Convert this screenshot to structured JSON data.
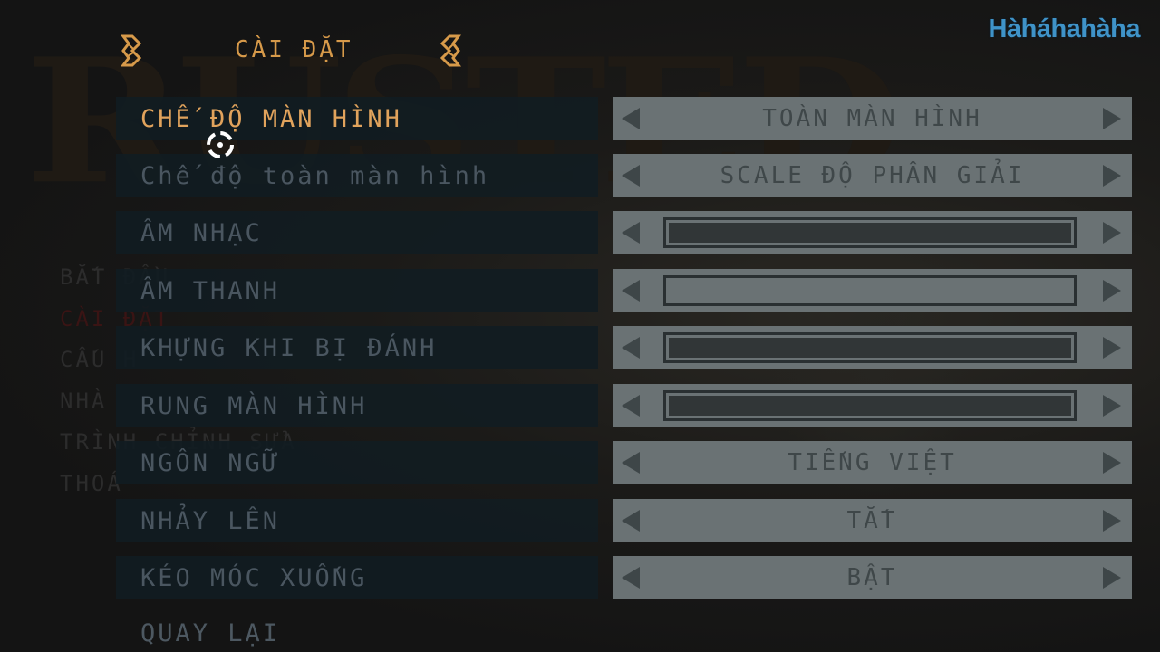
{
  "watermark": "Hàháhahàha",
  "title": "CÀI ĐẶT",
  "background_menu": [
    "BẮT ĐẦU",
    "CÀI ĐẶT",
    "CẤU H",
    "NHÀ",
    "TRÌNH CHỈNH SỬA",
    "THOÁ"
  ],
  "settings": [
    {
      "label": "CHẾ ĐỘ MÀN HÌNH",
      "value": "TOÀN MÀN HÌNH",
      "active": true
    },
    {
      "label": "Chế độ toàn màn hình",
      "value": "SCALE ĐỘ PHÂN GIẢI"
    },
    {
      "label": "ÂM NHẠC",
      "level": 1.0
    },
    {
      "label": "ÂM THANH",
      "level": 0.0
    },
    {
      "label": "KHỰNG KHI BỊ ĐÁNH",
      "level": 1.0
    },
    {
      "label": "RUNG MÀN HÌNH",
      "level": 1.0
    },
    {
      "label": "NGÔN NGỮ",
      "value": "TIẾNG VIỆT"
    },
    {
      "label": "NHẢY LÊN",
      "value": "TẮT"
    },
    {
      "label": "KÉO MÓC XUỐNG",
      "value": "BẬT"
    }
  ],
  "back_label": "QUAY LẠI",
  "icons": {
    "leaf": "leaf-ornament-icon",
    "cursor": "crosshair-cursor-icon",
    "left": "arrow-left-icon",
    "right": "arrow-right-icon"
  },
  "colors": {
    "active": "#e1a35c",
    "inactive": "#4a5660",
    "title": "#d79a4a",
    "watermark": "#3f93c8"
  }
}
